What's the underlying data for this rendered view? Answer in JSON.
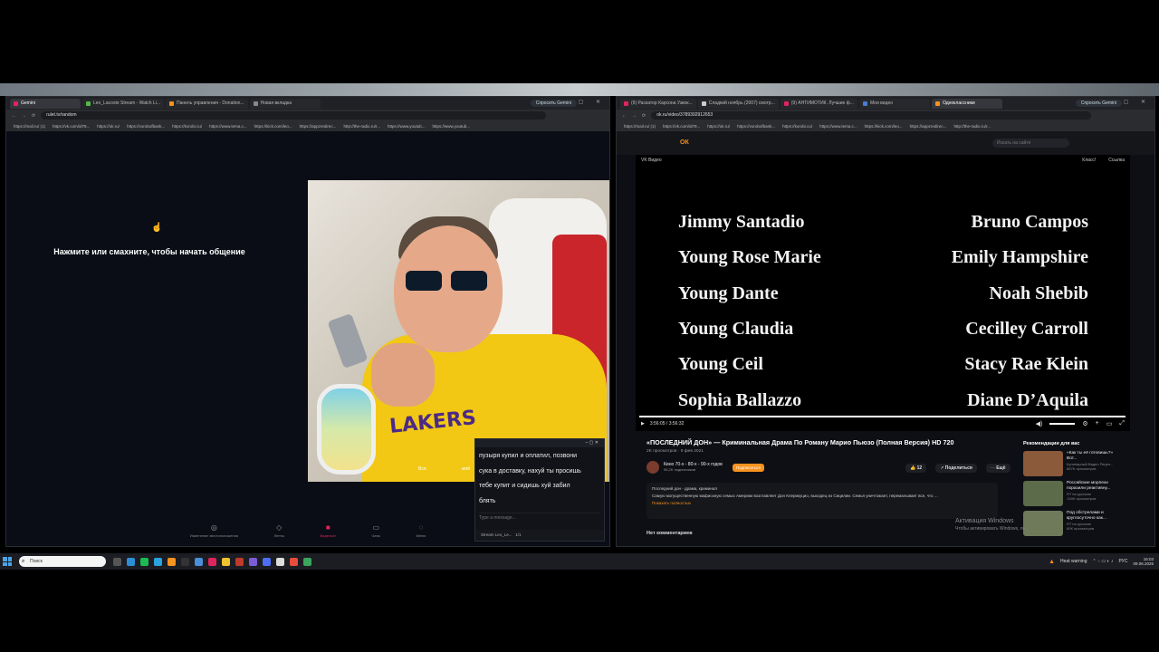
{
  "left_window": {
    "tabs": [
      {
        "label": "Gemini",
        "color": "#e0245e"
      },
      {
        "label": "Leo_Lacoste Stream - Watch Li...",
        "color": "#53b947"
      },
      {
        "label": "Панель управления - Donation...",
        "color": "#f7931e"
      },
      {
        "label": "Новая вкладка",
        "color": "#888888"
      }
    ],
    "gemini_button": "Спросить Gemini",
    "url": "rulet.tv/random",
    "bookmarks": [
      "https://mail.ru/ (1)",
      "https://vk.com/id79...",
      "https://ok.ru/",
      "https://vorobofbank...",
      "https://korobi.cu/",
      "https://www.tema.c...",
      "https://kick.com/leo...",
      "https://appzredirec...",
      "http://the-radio.ru/r...",
      "https://www.youtub...",
      "https://www.youtub..."
    ],
    "prompt": "Нажмите или смахните, чтобы начать общение",
    "tap_icon": "hand-tap-icon",
    "video_overlay": {
      "left": "Вся",
      "right": "мой"
    },
    "chat": {
      "lines": [
        "пузыря купил и оплатил, позвони",
        "сука в доставку, нахуй ты просишь",
        "тебе купит и сидишь хуй забил",
        "блять"
      ],
      "input_placeholder": "Type a message...",
      "footer": "Stream Leo_Le...",
      "footer_count": "1/1"
    },
    "bottom_nav": [
      {
        "label": "Изменение местоположения",
        "icon": "location-icon"
      },
      {
        "label": "Ленты",
        "icon": "feed-icon"
      },
      {
        "label": "Видеочат",
        "icon": "videochat-icon"
      },
      {
        "label": "Чаты",
        "icon": "chat-icon"
      },
      {
        "label": "Меню",
        "icon": "menu-icon"
      }
    ]
  },
  "right_window": {
    "tabs": [
      {
        "label": "(9) Раскатор Карсона Узвок...",
        "color": "#e0245e"
      },
      {
        "label": "Сладкий ноябрь (2007) смотр...",
        "color": "#cccccc"
      },
      {
        "label": "(9) АНТИМОТИК. Лучшие ф...",
        "color": "#e0245e"
      },
      {
        "label": "Мои видео",
        "color": "#4a7bd0"
      },
      {
        "label": "Одноклассники",
        "color": "#f7931e"
      }
    ],
    "gemini_button": "Спросить Gemini",
    "url": "ok.ru/video/3789392912653",
    "bookmarks": [
      "https://mail.ru/ (1)",
      "https://vk.com/id79...",
      "https://ok.ru/",
      "https://vorobofbank...",
      "https://korobi.cu/",
      "https://www.tema.c...",
      "https://kick.com/leo...",
      "https://appzredirec...",
      "http://the-radio.ru/r..."
    ],
    "ok_logo": "ОК",
    "search_placeholder": "Искать на сайте",
    "player": {
      "source": "VK Видео",
      "top_actions": [
        "Класс!",
        "Ссылка"
      ],
      "credits_left": [
        "Jimmy Santadio",
        "Young Rose Marie",
        "Young Dante",
        "Young Claudia",
        "Young Ceil",
        "Sophia Ballazzo"
      ],
      "credits_right": [
        "Bruno Campos",
        "Emily Hampshire",
        "Noah Shebib",
        "Cecilley Carroll",
        "Stacy Rae Klein",
        "Diane D’Aquila"
      ],
      "time": "3:56:05 / 3:56:32",
      "progress": 0.998
    },
    "video_title": "«ПОСЛЕДНИЙ ДОН» — Криминальная Драма По Роману Марио Пьюзо (Полная Версия) HD 720",
    "video_meta": "2K просмотров · 9 фев 2021",
    "channel": {
      "name": "Кино 70-х - 80-х - 90-х годов",
      "subs": "55,2K подписчиков",
      "subscribe": "Подписаться"
    },
    "actions": [
      "12",
      "Поделиться",
      "Ещё"
    ],
    "description": {
      "line1": "Последний дон - драма, криминал",
      "line2": "Самую могущественную мафиозную семью Америки возглавляет Дон Клерикуцио, выходец из Сицилии. Семья уничтожает, перемалывает все, что ...",
      "more": "Показать полностью"
    },
    "comments": "Нет комментариев",
    "recommendations": {
      "title": "Рекомендации для вас",
      "items": [
        {
          "title": "«Как ты её готовишь?» Вот...",
          "channel": "Кулинарный Видео Рецеп...",
          "views": "867K просмотров",
          "color": "#8a5a3b"
        },
        {
          "title": "Российские морпехи поразили реактивну...",
          "channel": "RT на русском",
          "views": "134K просмотров",
          "color": "#5c6b4a"
        },
        {
          "title": "Под обстрелами и круглосуточно как...",
          "channel": "RT на русском",
          "views": "80K просмотров",
          "color": "#6e7a5a"
        }
      ]
    },
    "windows_activation": {
      "title": "Активация Windows",
      "subtitle": "Чтобы активировать Windows, пе..."
    }
  },
  "taskbar": {
    "search_placeholder": "Поиск",
    "tray_warning": "Heat warning",
    "lang": "РУС",
    "time": "16:03",
    "date": "09.06.2025"
  }
}
